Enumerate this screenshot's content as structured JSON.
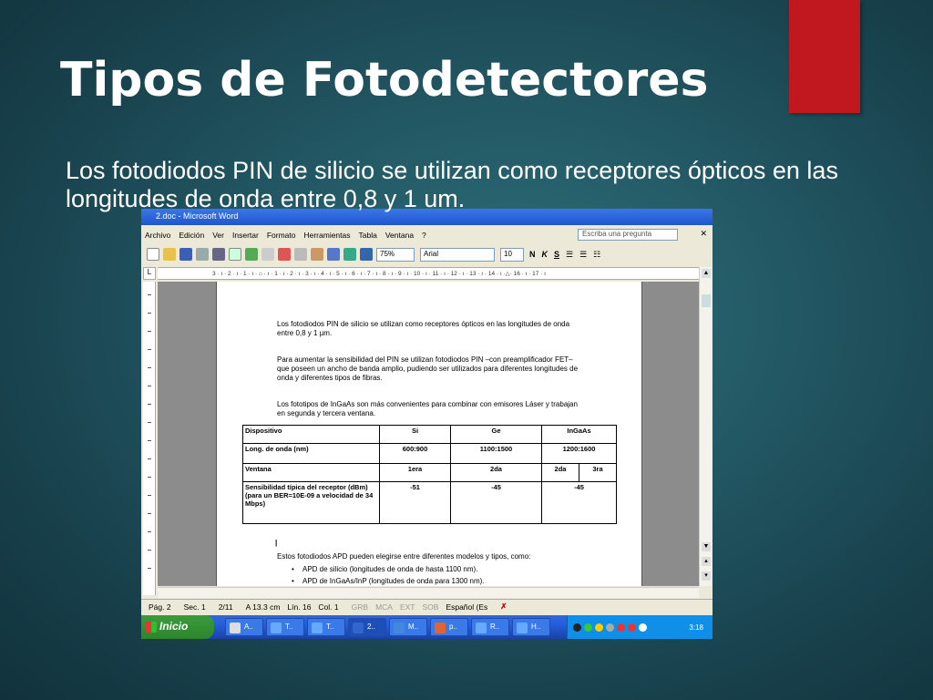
{
  "slide": {
    "title": "Tipos de Fotodetectores",
    "body": "Los fotodiodos PIN de silicio se utilizan como receptores ópticos en las longitudes de onda entre 0,8 y 1 um.",
    "accent_color": "#c0181e"
  },
  "word": {
    "window_title": "2.doc - Microsoft Word",
    "menu": [
      "Archivo",
      "Edición",
      "Ver",
      "Insertar",
      "Formato",
      "Herramientas",
      "Tabla",
      "Ventana",
      "?"
    ],
    "ask_placeholder": "Escriba una pregunta",
    "toolbar": {
      "zoom": "75%",
      "font": "Arial",
      "size": "10",
      "bold": "N",
      "italic": "K",
      "underline": "S"
    },
    "ruler_text": "3 · ı · 2 · ı · 1 · ı · ⌂ · ı · 1 · ı · 2 · ı · 3 · ı · 4 · ı · 5 · ı · 6 · ı · 7 · ı · 8 · ı · 9 · ı · 10 · ı · 11 · ı · 12 · ı · 13 · ı · 14 · ı ·△· 16 · ı · 17 · ı",
    "doc": {
      "p1": "Los fotodiodos PIN de silicio se utilizan como receptores ópticos en las longitudes de onda entre 0,8 y 1 µm.",
      "p2": "Para aumentar la sensibilidad del PIN se utilizan fotodiodos PIN –con preamplificador FET– que poseen un ancho de banda amplio, pudiendo ser utilizados para diferentes longitudes de onda y diferentes tipos de fibras.",
      "p3": "Los fototipos de InGaAs son más convenientes para combinar con emisores Láser y trabajan en segunda y tercera ventana.",
      "table": {
        "rows": [
          [
            "Dispositivo",
            "Si",
            "Ge",
            "InGaAs",
            ""
          ],
          [
            "Long. de onda  (nm)",
            "600:900",
            "1100:1500",
            "1200:1600",
            ""
          ],
          [
            "Ventana",
            "1era",
            "2da",
            "2da",
            "3ra"
          ],
          [
            "Sensibilidad típica del receptor (dBm) (para un BER=10E-09 a velocidad de 34 Mbps)",
            "-51",
            "-45",
            "-45",
            ""
          ]
        ]
      },
      "cursor": "|",
      "p4": "Estos fotodiodos APD pueden elegirse entre diferentes modelos y tipos, como:",
      "bullets": [
        "APD de silicio (longitudes de onda de hasta 1100 nm).",
        "APD de InGaAs/InP (longitudes de onda para 1300 nm)."
      ]
    },
    "status": {
      "page": "Pág. 2",
      "section": "Sec. 1",
      "pages": "2/11",
      "at": "A 13.3 cm",
      "line": "Lín. 16",
      "col": "Col. 1",
      "modes": [
        "GRB",
        "MCA",
        "EXT",
        "SOB"
      ],
      "language": "Español (Es"
    },
    "taskbar": {
      "start": "Inicio",
      "tasks": [
        "A..",
        "T..",
        "T..",
        "2..",
        "M..",
        "p..",
        "R..",
        "H.."
      ],
      "clock": "3:18"
    }
  }
}
